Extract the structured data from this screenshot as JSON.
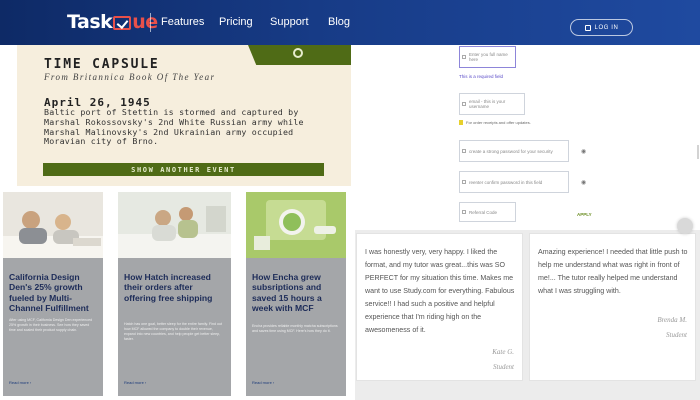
{
  "header": {
    "logo": {
      "part1": "Task",
      "part2": "ue"
    },
    "nav": [
      "Features",
      "Pricing",
      "Support",
      "Blog"
    ],
    "login_label": "LOG IN"
  },
  "capsule": {
    "title": "TIME CAPSULE",
    "subtitle": "From Britannica Book Of The Year",
    "date": "April 26, 1945",
    "text": "Baltic port of Stettin is stormed and captured by Marshal Rokossovsky's 2nd White Russian army while Marshal Malinovsky's 2nd Ukrainian army occupied Moravian city of Brno.",
    "button": "SHOW ANOTHER EVENT"
  },
  "form": {
    "name_placeholder": "Enter you full name here",
    "required": "This is a required field",
    "email_placeholder": "email - this is your username",
    "newsletter": "For order receipts and offer updates.",
    "password_placeholder": "create a strong password for your security",
    "confirm_placeholder": "reenter confirm password in this field",
    "referral_placeholder": "Referral Code",
    "apply": "APPLY"
  },
  "cases": [
    {
      "title": "California Design Den's 25% growth fueled by Multi-Channel Fulfillment",
      "body": "After using MCF, California Design Den experienced 25% growth in their business. See how they saved time and scaled their product supply chain.",
      "more": "Read more ›"
    },
    {
      "title": "How Hatch increased their orders after offering free shipping",
      "body": "Hatch has one goal, better sleep for the entire family. Find out how MCF allowed the company to double their revenue, expand into new countries, and help people get better sleep, faster.",
      "more": "Read more ›"
    },
    {
      "title": "How Encha grew subsriptions and saved 15 hours a week with MCF",
      "body": "Encha provides reliable monthly matcha subscriptions and saves time using MCF. Here's how they do it.",
      "more": "Read more ›"
    }
  ],
  "testimonials": [
    {
      "quote": "I was honestly very, very happy. I liked the format, and my tutor was great...this was SO PERFECT for my situation this time. Makes me want to use Study.com for everything. Fabulous service!! I had such a positive and helpful experience that I'm riding high on the awesomeness of it.",
      "name": "Kate G.",
      "role": "Student"
    },
    {
      "quote": "Amazing experience! I needed that little push to help me understand what was right in front of me!... The tutor really helped me understand what I was struggling with.",
      "name": "Brenda M.",
      "role": "Student"
    }
  ],
  "colors": {
    "header": "#173b86",
    "accent": "#e8504a",
    "olive": "#4f6b16",
    "case_title": "#1c2b58"
  }
}
